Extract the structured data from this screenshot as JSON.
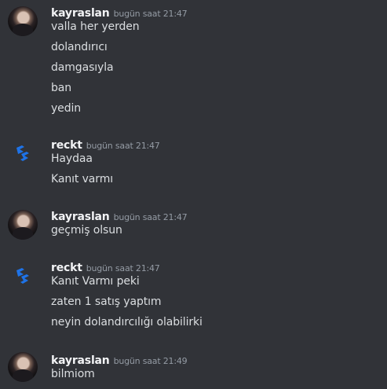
{
  "groups": [
    {
      "username": "kayraslan",
      "timestamp": "bugün saat 21:47",
      "avatar_icon": "user-photo-avatar",
      "lines": [
        "valla her yerden",
        "dolandırıcı",
        "damgasıyla",
        "ban",
        "yedin"
      ]
    },
    {
      "username": "reckt",
      "timestamp": "bugün saat 21:47",
      "avatar_icon": "reckt-logo-icon",
      "lines": [
        "Haydaa",
        "Kanıt varmı"
      ]
    },
    {
      "username": "kayraslan",
      "timestamp": "bugün saat 21:47",
      "avatar_icon": "user-photo-avatar",
      "lines": [
        "geçmiş olsun"
      ]
    },
    {
      "username": "reckt",
      "timestamp": "bugün saat 21:47",
      "avatar_icon": "reckt-logo-icon",
      "lines": [
        "Kanıt Varmı peki",
        "zaten 1 satış yaptım",
        "neyin dolandırcılığı olabilirki"
      ]
    },
    {
      "username": "kayraslan",
      "timestamp": "bugün saat 21:49",
      "avatar_icon": "user-photo-avatar",
      "lines": [
        "bilmiom"
      ]
    }
  ],
  "colors": {
    "background": "#313338",
    "username": "#f2f3f5",
    "timestamp": "#949ba4",
    "text": "#dbdee1",
    "logo": "#1e73e8"
  }
}
